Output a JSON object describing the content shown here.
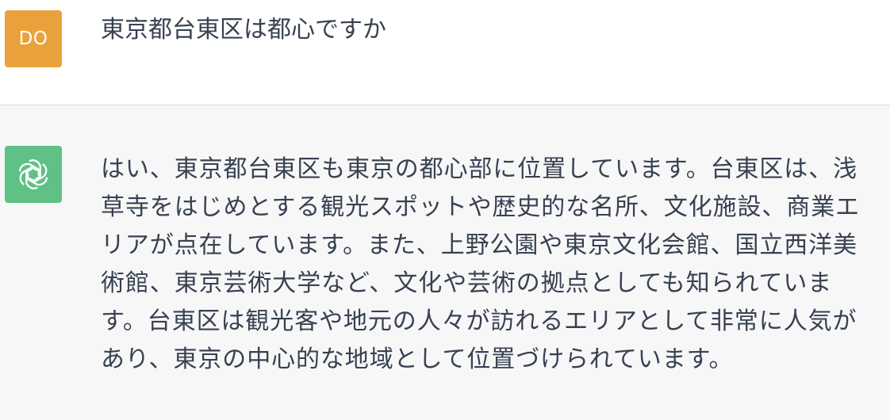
{
  "user_message": {
    "avatar_initials": "DO",
    "avatar_color": "#e9a23b",
    "text": "東京都台東区は都心ですか"
  },
  "assistant_message": {
    "avatar_icon": "openai-logo-icon",
    "avatar_color": "#5fc185",
    "text": "はい、東京都台東区も東京の都心部に位置しています。台東区は、浅草寺をはじめとする観光スポットや歴史的な名所、文化施設、商業エリアが点在しています。また、上野公園や東京文化会館、国立西洋美術館、東京芸術大学など、文化や芸術の拠点としても知られています。台東区は観光客や地元の人々が訪れるエリアとして非常に人気があり、東京の中心的な地域として位置づけられています。"
  }
}
